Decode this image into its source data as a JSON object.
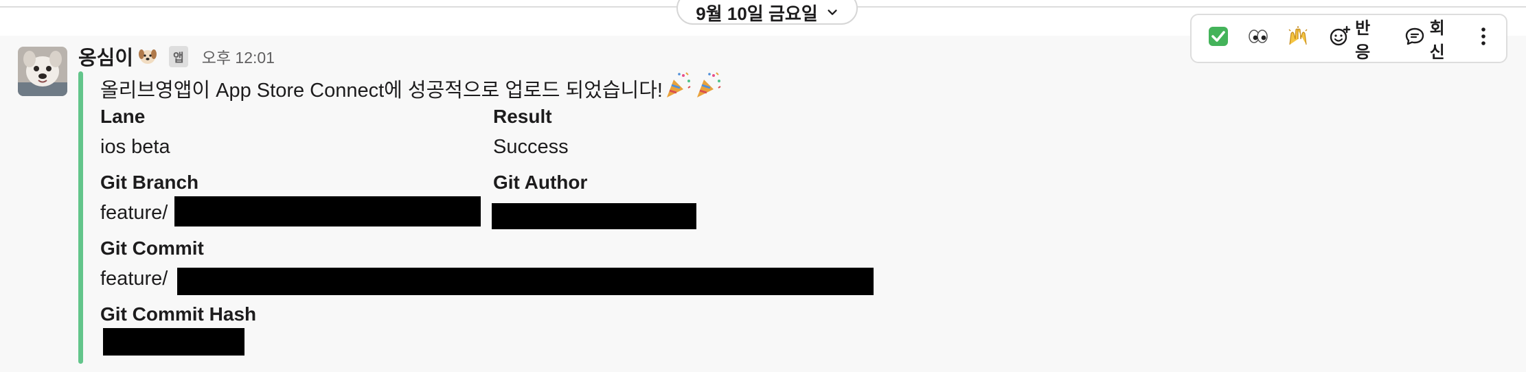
{
  "date_divider": {
    "label": "9월 10일 금요일"
  },
  "toolbar": {
    "react_label": "반응",
    "reply_label": "회신",
    "quick_emojis": [
      "white-check-mark",
      "eyes",
      "raised-hands"
    ]
  },
  "message": {
    "sender": "옹심이",
    "app_badge": "앱",
    "timestamp": "오후 12:01",
    "text": "올리브영앱이 App Store Connect에 성공적으로 업로드 되었습니다!",
    "accent_color": "#63c58b",
    "fields": {
      "lane": {
        "title": "Lane",
        "value": "ios beta"
      },
      "result": {
        "title": "Result",
        "value": "Success"
      },
      "git_branch": {
        "title": "Git Branch",
        "value_prefix": "feature/"
      },
      "git_author": {
        "title": "Git Author"
      },
      "git_commit": {
        "title": "Git Commit",
        "value_prefix": "feature/"
      },
      "git_commit_hash": {
        "title": "Git Commit Hash"
      }
    }
  }
}
